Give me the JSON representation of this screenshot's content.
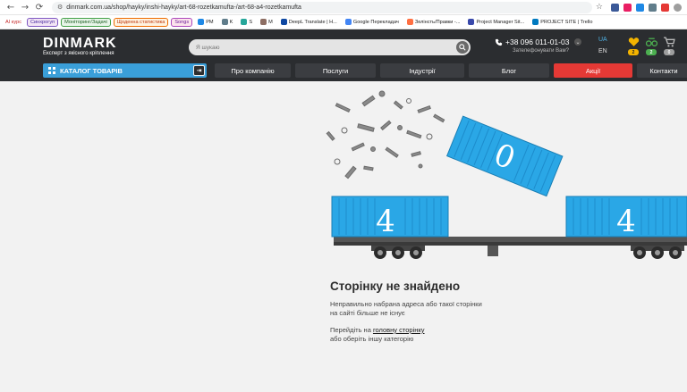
{
  "browser": {
    "url": "dinmark.com.ua/shop/hayky/inshi-hayky/art-68-rozetkamufta-/art-68-a4-rozetkamufta",
    "bookmarks": [
      {
        "label": "AI курс",
        "style": "tag-red"
      },
      {
        "label": "Синхрогуп",
        "style": "tag-pill"
      },
      {
        "label": "Моніторинг/Задачі",
        "style": "tag-green"
      },
      {
        "label": "Щоденна статистика",
        "style": "tag-orange"
      },
      {
        "label": "Songs",
        "style": "tag-purple"
      },
      {
        "label": "PM",
        "style": "plain"
      },
      {
        "label": "K",
        "style": "plain"
      },
      {
        "label": "S",
        "style": "plain"
      },
      {
        "label": "M",
        "style": "plain"
      },
      {
        "label": "DeepL Translate | H...",
        "style": "plain"
      },
      {
        "label": "Google Перекладач",
        "style": "plain"
      },
      {
        "label": "Зелінсть/Правки -...",
        "style": "plain"
      },
      {
        "label": "Project Manager Sit...",
        "style": "plain"
      },
      {
        "label": "PROJECT SITE | Trello",
        "style": "plain"
      }
    ]
  },
  "header": {
    "logo": "DINMARK",
    "tagline": "Експерт з якісного кріплення",
    "search_placeholder": "Я шукаю",
    "phone": "+38 096 011-01-03",
    "callback": "Зателефонувати Вам?",
    "lang_active": "UA",
    "lang_other": "EN",
    "badges": {
      "favorites": "2",
      "compare": "2",
      "cart": "0"
    },
    "colors": {
      "accent": "#3a9fd9",
      "promo": "#e53935"
    }
  },
  "nav": {
    "catalog_label": "КАТАЛОГ ТОВАРІВ",
    "items": [
      {
        "label": "Про компанію",
        "type": "normal"
      },
      {
        "label": "Послуги",
        "type": "normal"
      },
      {
        "label": "Індустрії",
        "type": "normal"
      },
      {
        "label": "Блог",
        "type": "normal"
      },
      {
        "label": "Акції",
        "type": "promo"
      },
      {
        "label": "Контакти",
        "type": "normal"
      }
    ]
  },
  "error": {
    "digit_left": "4",
    "digit_middle": "0",
    "digit_right": "4",
    "title": "Сторінку не знайдено",
    "description": "Неправильно набрана адреса або такої сторінки на сайті більше не існує",
    "hint_prefix": "Перейдіть на ",
    "hint_link": "головну сторінку",
    "hint_suffix": "або оберіть іншу категорію"
  }
}
